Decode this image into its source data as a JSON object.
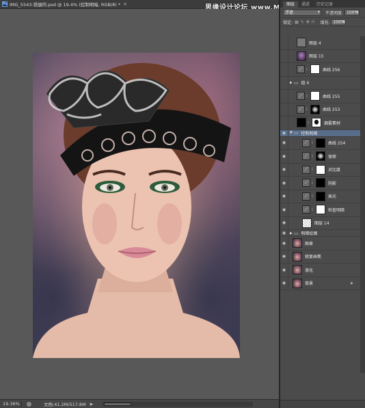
{
  "document": {
    "title": "IMG_5543-铁腿的.psd @ 19.4% (控制明暗, RGB/8) *",
    "close": "×"
  },
  "watermark": "思缘设计论坛 www.MISSYUAN.COM",
  "panel": {
    "tabs": [
      "图层",
      "通道",
      "历史记录"
    ],
    "blend_mode": "浮遮",
    "opacity_label": "不透明度:",
    "opacity_value": "100%",
    "lock_label": "锁定:",
    "fill_label": "填充:",
    "fill_value": "100%"
  },
  "layers": [
    {
      "name": "图层 4",
      "thumb": "grey",
      "visible": false,
      "type": "pixel"
    },
    {
      "name": "图层 15",
      "thumb": "ps-thumb",
      "visible": false,
      "type": "pixel"
    },
    {
      "name": "曲线 256",
      "thumb": "white",
      "visible": false,
      "type": "adjust"
    },
    {
      "name": "组 4",
      "visible": false,
      "type": "group"
    },
    {
      "name": "曲线 255",
      "thumb": "white",
      "visible": false,
      "type": "adjust"
    },
    {
      "name": "曲线 253",
      "thumb": "mask-dark",
      "visible": false,
      "type": "adjust"
    },
    {
      "name": "烟雾素材",
      "thumb": "mask-face",
      "visible": false,
      "type": "smart"
    },
    {
      "name": "控制明暗",
      "visible": true,
      "type": "group",
      "selected": true
    },
    {
      "name": "曲线 254",
      "thumb": "black",
      "visible": true,
      "type": "adjust"
    },
    {
      "name": "保密",
      "thumb": "mask-dark",
      "visible": true,
      "type": "adjust"
    },
    {
      "name": "对比度",
      "thumb": "white",
      "visible": true,
      "type": "adjust"
    },
    {
      "name": "阴影",
      "thumb": "black",
      "visible": true,
      "type": "adjust"
    },
    {
      "name": "高光",
      "thumb": "black",
      "visible": true,
      "type": "adjust"
    },
    {
      "name": "检查明暗",
      "thumb": "white",
      "visible": true,
      "type": "adjust"
    },
    {
      "name": "图层 14",
      "thumb": "checker",
      "visible": true,
      "type": "pixel"
    },
    {
      "name": "明暗绘图",
      "visible": true,
      "type": "group"
    },
    {
      "name": "图章",
      "thumb": "photo-thumb",
      "visible": true,
      "type": "pixel"
    },
    {
      "name": "修复画笔",
      "thumb": "photo-thumb",
      "visible": true,
      "type": "pixel"
    },
    {
      "name": "液化",
      "thumb": "photo-thumb",
      "visible": true,
      "type": "pixel"
    },
    {
      "name": "背景",
      "thumb": "photo-thumb",
      "visible": true,
      "type": "background"
    }
  ],
  "status": {
    "zoom": "19.36%",
    "doc_info": "文档:41.2M/517.8M",
    "arrow": "▶"
  }
}
